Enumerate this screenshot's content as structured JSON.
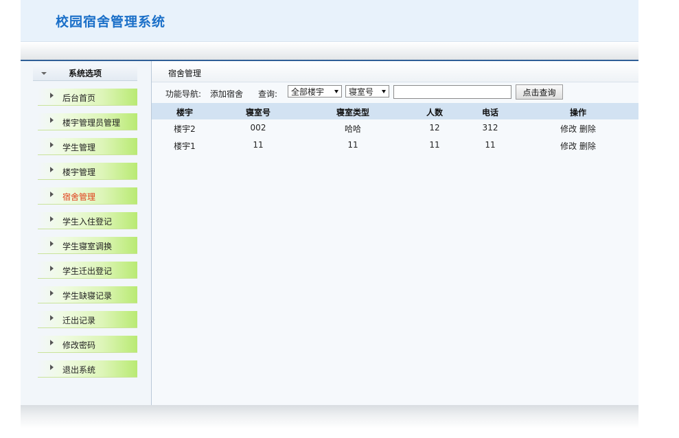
{
  "app": {
    "title": "校园宿舍管理系统"
  },
  "sidebar": {
    "header": "系统选项",
    "items": [
      {
        "label": "后台首页"
      },
      {
        "label": "楼宇管理员管理"
      },
      {
        "label": "学生管理"
      },
      {
        "label": "楼宇管理"
      },
      {
        "label": "宿舍管理",
        "active": true
      },
      {
        "label": "学生入住登记"
      },
      {
        "label": "学生寝室调换"
      },
      {
        "label": "学生迁出登记"
      },
      {
        "label": "学生缺寝记录"
      },
      {
        "label": "迁出记录"
      },
      {
        "label": "修改密码"
      },
      {
        "label": "退出系统"
      }
    ]
  },
  "main": {
    "breadcrumb": "宿舍管理",
    "toolbar": {
      "nav_label": "功能导航:",
      "add_link": "添加宿舍",
      "query_label": "查询:",
      "building_select": "全部楼宇",
      "room_select": "寝室号",
      "search_value": "",
      "search_button": "点击查询"
    },
    "table": {
      "columns": [
        "楼宇",
        "寝室号",
        "寝室类型",
        "人数",
        "电话",
        "操作"
      ],
      "rows": [
        {
          "building": "楼宇2",
          "room": "002",
          "type": "哈哈",
          "count": "12",
          "phone": "312",
          "edit": "修改",
          "delete": "删除"
        },
        {
          "building": "楼宇1",
          "room": "11",
          "type": "11",
          "count": "11",
          "phone": "11",
          "edit": "修改",
          "delete": "删除"
        }
      ]
    }
  },
  "colors": {
    "title": "#1a6fc8",
    "active_menu": "#e0401b",
    "table_header": "#d2e2f2",
    "accent_line": "#2f5f97"
  }
}
